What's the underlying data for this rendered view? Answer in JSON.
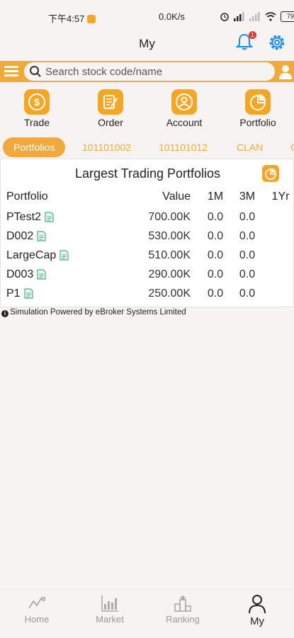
{
  "status_bar": {
    "time": "下午4:57",
    "network_speed": "0.0K/s",
    "battery": "79"
  },
  "header": {
    "title": "My",
    "notification_count": "1"
  },
  "search": {
    "placeholder": "Search stock code/name"
  },
  "quick_actions": [
    {
      "label": "Trade",
      "icon": "dollar-icon"
    },
    {
      "label": "Order",
      "icon": "order-icon"
    },
    {
      "label": "Account",
      "icon": "account-icon"
    },
    {
      "label": "Portfolio",
      "icon": "pie-chart-icon"
    }
  ],
  "tabs": [
    {
      "label": "Portfolios",
      "active": true
    },
    {
      "label": "101101002"
    },
    {
      "label": "101101012"
    },
    {
      "label": "CLAN"
    }
  ],
  "panel": {
    "title": "Largest Trading Portfolios",
    "columns": [
      "Portfolio",
      "Value",
      "1M",
      "3M",
      "1Yr"
    ],
    "rows": [
      {
        "name": "PTest2",
        "value": "700.00K",
        "m1": "0.0",
        "m3": "0.0",
        "yr1": ""
      },
      {
        "name": "D002",
        "value": "530.00K",
        "m1": "0.0",
        "m3": "0.0",
        "yr1": ""
      },
      {
        "name": "LargeCap",
        "value": "510.00K",
        "m1": "0.0",
        "m3": "0.0",
        "yr1": ""
      },
      {
        "name": "D003",
        "value": "290.00K",
        "m1": "0.0",
        "m3": "0.0",
        "yr1": ""
      },
      {
        "name": "P1",
        "value": "250.00K",
        "m1": "0.0",
        "m3": "0.0",
        "yr1": ""
      }
    ]
  },
  "footnote": "Simulation Powered by eBroker Systems Limited",
  "bottom_nav": [
    {
      "label": "Home",
      "icon": "home-chart-icon"
    },
    {
      "label": "Market",
      "icon": "market-icon"
    },
    {
      "label": "Ranking",
      "icon": "ranking-icon"
    },
    {
      "label": "My",
      "icon": "person-icon",
      "active": true
    }
  ],
  "colors": {
    "accent": "#f2a93b",
    "background": "#f7f3f2",
    "doc_icon": "#4caf7d",
    "badge": "#e53935",
    "link_blue": "#1e88e5"
  }
}
